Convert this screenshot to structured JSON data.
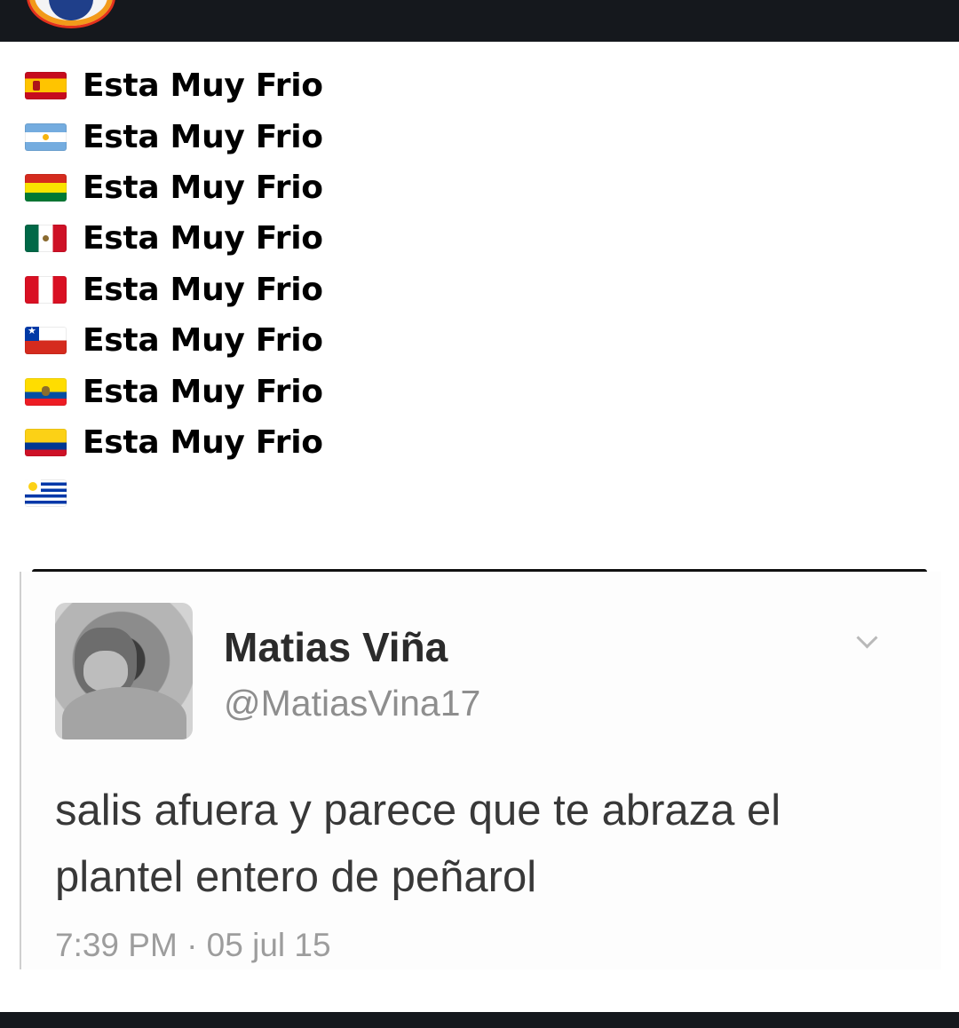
{
  "meme": {
    "lines": [
      {
        "flag_icon": "spain-flag-icon",
        "text": "Esta Muy Frio"
      },
      {
        "flag_icon": "argentina-flag-icon",
        "text": "Esta Muy Frio"
      },
      {
        "flag_icon": "bolivia-flag-icon",
        "text": "Esta Muy Frio"
      },
      {
        "flag_icon": "mexico-flag-icon",
        "text": "Esta Muy Frio"
      },
      {
        "flag_icon": "peru-flag-icon",
        "text": "Esta Muy Frio"
      },
      {
        "flag_icon": "chile-flag-icon",
        "text": "Esta Muy Frio"
      },
      {
        "flag_icon": "ecuador-flag-icon",
        "text": "Esta Muy Frio"
      },
      {
        "flag_icon": "colombia-flag-icon",
        "text": "Esta Muy Frio"
      },
      {
        "flag_icon": "uruguay-flag-icon",
        "text": ""
      }
    ]
  },
  "tweet": {
    "author_name": "Matias Viña",
    "handle": "@MatiasVina17",
    "text_line1": "salis afuera y parece que te abraza el",
    "text_line2": "plantel entero de peñarol",
    "timestamp": "7:39 PM · 05 jul 15",
    "menu_icon": "chevron-down-icon"
  },
  "colors": {
    "app_bar": "#15181d",
    "tweet_text": "#383838",
    "handle": "#8e8e8e"
  }
}
